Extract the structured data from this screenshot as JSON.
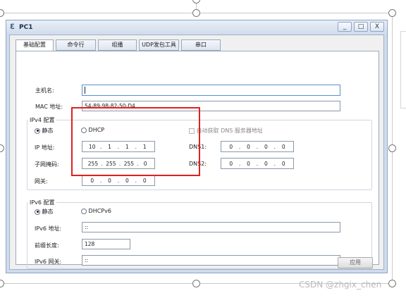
{
  "window": {
    "title": "PC1",
    "minimize": "_",
    "maximize": "□",
    "close": "X"
  },
  "tabs": [
    "基础配置",
    "命令行",
    "组播",
    "UDP发包工具",
    "串口"
  ],
  "basic": {
    "hostname_label": "主机名:",
    "hostname_value": "",
    "mac_label": "MAC 地址:",
    "mac_value": "54-89-98-82-50-D4"
  },
  "ipv4": {
    "group_title": "IPv4 配置",
    "static_label": "静态",
    "dhcp_label": "DHCP",
    "mode": "static",
    "auto_dns_label": "自动获取 DNS 服务器地址",
    "ip_label": "IP 地址:",
    "ip": [
      "10",
      "1",
      "1",
      "1"
    ],
    "mask_label": "子网掩码:",
    "mask": [
      "255",
      "255",
      "255",
      "0"
    ],
    "gateway_label": "网关:",
    "gateway": [
      "0",
      "0",
      "0",
      "0"
    ],
    "dns1_label": "DNS1:",
    "dns1": [
      "0",
      "0",
      "0",
      "0"
    ],
    "dns2_label": "DNS2:",
    "dns2": [
      "0",
      "0",
      "0",
      "0"
    ]
  },
  "ipv6": {
    "group_title": "IPv6 配置",
    "static_label": "静态",
    "dhcpv6_label": "DHCPv6",
    "mode": "static",
    "ip_label": "IPv6 地址:",
    "ip_value": "::",
    "prefix_label": "前缀长度:",
    "prefix_value": "128",
    "gateway_label": "IPv6 网关:",
    "gateway_value": "::"
  },
  "apply_button": "应用",
  "watermark": "CSDN @zhgix_chen",
  "colors": {
    "highlight": "#e02020",
    "title_text": "#1c2f4a",
    "focus_border": "#5b8ecf"
  }
}
